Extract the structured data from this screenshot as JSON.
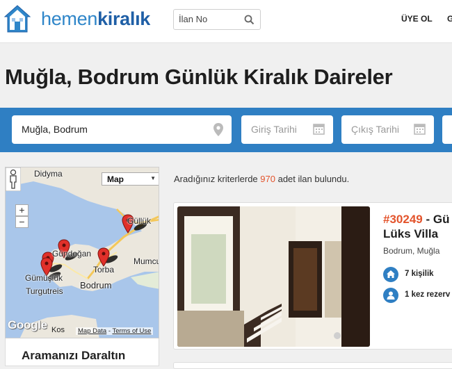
{
  "header": {
    "brand_light": "hemen",
    "brand_bold": "kiralık",
    "search_placeholder": "İlan No",
    "signup": "ÜYE OL",
    "cut_item": "G"
  },
  "page_title": "Muğla, Bodrum Günlük Kiralık Daireler",
  "filters": {
    "location": "Muğla, Bodrum",
    "checkin_placeholder": "Giriş Tarihi",
    "checkout_placeholder": "Çıkış Tarihi"
  },
  "map": {
    "type_label": "Map",
    "zoom_in": "+",
    "zoom_out": "−",
    "labels": {
      "didyma": "Didyma",
      "gulluk": "Güllük",
      "gundogan": "Gündoğan",
      "torba": "Torba",
      "mumcular": "Mumcu",
      "gumusluk": "Gümüşlük",
      "bodrum": "Bodrum",
      "turgutreis": "Turgutreis",
      "kos": "Kos"
    },
    "google": "Google",
    "attribution_data": "Map Data",
    "attribution_sep": " - ",
    "attribution_terms": "Terms of Use"
  },
  "sidebar": {
    "narrow_title": "Aramanızı Daraltın"
  },
  "results": {
    "prefix": "Aradığınız kriterlerde ",
    "count": "970",
    "suffix": " adet ilan bulundu."
  },
  "listing": {
    "id": "#30249",
    "title_rest": " - Gü",
    "title_line2": "Lüks Villa",
    "location": "Bodrum, Muğla",
    "capacity": "7 kişilik",
    "reservation": "1 kez rezerv"
  },
  "colors": {
    "accent": "#2f7fc3",
    "brand": "#1f5fa6",
    "highlight": "#e3542c"
  },
  "icons": [
    "house-logo-icon",
    "search-icon",
    "map-pin-icon",
    "calendar-icon",
    "pegman-icon",
    "home-icon",
    "user-icon"
  ]
}
